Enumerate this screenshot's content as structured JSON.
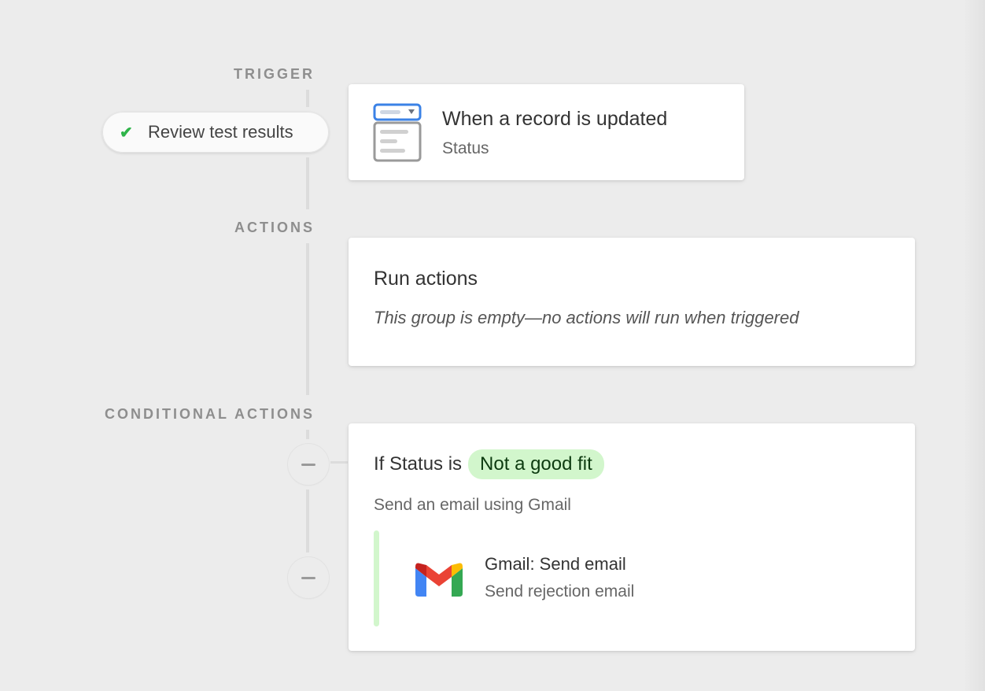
{
  "sections": {
    "trigger": "TRIGGER",
    "actions": "ACTIONS",
    "conditional": "CONDITIONAL ACTIONS"
  },
  "review_button": {
    "label": "Review test results",
    "icon": "check-icon",
    "icon_color": "#2fb44a"
  },
  "trigger_card": {
    "icon": "record-form-icon",
    "title": "When a record is updated",
    "subtitle": "Status"
  },
  "actions_card": {
    "title": "Run actions",
    "empty_message": "This group is empty—no actions will run when triggered"
  },
  "conditional_card": {
    "condition_prefix": "If Status is",
    "condition_value": "Not a good fit",
    "condition_color": "#d2f6cc",
    "description": "Send an email using Gmail",
    "action": {
      "icon": "gmail-icon",
      "title": "Gmail: Send email",
      "subtitle": "Send rejection email"
    }
  },
  "side_buttons": [
    {
      "icon": "minus-icon"
    },
    {
      "icon": "minus-icon"
    }
  ]
}
